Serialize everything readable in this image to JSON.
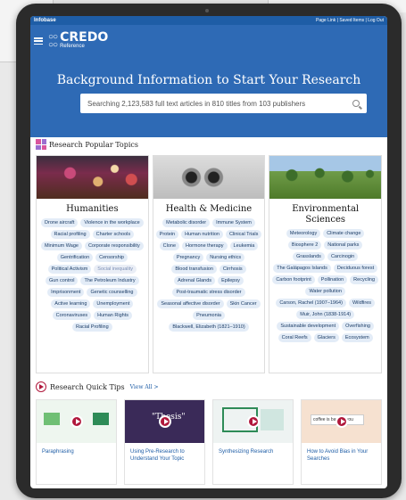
{
  "topstrip": {
    "brand": "Infobase",
    "links": "Page Link | Saved Items | Log Out"
  },
  "header": {
    "logo_word": "CREDO",
    "logo_sub": "Reference",
    "title": "Background Information to Start Your Research",
    "search_placeholder": "Searching 2,123,583 full text articles in 810 titles from 103 publishers"
  },
  "topics": {
    "heading": "Research Popular Topics",
    "columns": [
      {
        "title": "Humanities",
        "tags": [
          "Drone aircraft",
          "Violence in the workplace",
          "Racial profiling",
          "Charter schools",
          "Minimum Wage",
          "Corporate responsibility",
          "Gentrification",
          "Censorship",
          "Political Activism",
          "Social inequality",
          "Gun control",
          "The Petroleum Industry",
          "Imprisonment",
          "Genetic counselling",
          "Active learning",
          "Unemployment",
          "Coronaviruses",
          "Human Rights",
          "Racial Profiling"
        ]
      },
      {
        "title": "Health & Medicine",
        "tags": [
          "Metabolic disorder",
          "Immune System",
          "Protein",
          "Human nutrition",
          "Clinical Trials",
          "Clone",
          "Hormone therapy",
          "Leukemia",
          "Pregnancy",
          "Nursing ethics",
          "Blood transfusion",
          "Cirrhosis",
          "Adrenal Glands",
          "Epilepsy",
          "Post-traumatic stress disorder",
          "Seasonal affective disorder",
          "Skin Cancer",
          "Pneumonia",
          "Blackwell, Elizabeth (1821–1910)"
        ]
      },
      {
        "title": "Environmental Sciences",
        "tags": [
          "Meteorology",
          "Climate change",
          "Biosphere 2",
          "National parks",
          "Grasslands",
          "Carcinogin",
          "The Galápagos Islands",
          "Deciduous forest",
          "Carbon footprint",
          "Pollination",
          "Recycling",
          "Water pollution",
          "Carson, Rachel (1907–1964)",
          "Wildfires",
          "Muir, John (1838-1914)",
          "Sustainable development",
          "Overfishing",
          "Coral Reefs",
          "Glaciers",
          "Ecosystem"
        ]
      }
    ]
  },
  "tips": {
    "heading": "Research Quick Tips",
    "view_all": "View All >",
    "items": [
      {
        "title": "Paraphrasing"
      },
      {
        "title": "Using Pre-Research to Understand Your Topic",
        "thumb_text": "\"Thesis\""
      },
      {
        "title": "Synthesizing Research"
      },
      {
        "title": "How to Avoid Bias in Your Searches",
        "thumb_text": "coffee is bad for you"
      }
    ]
  },
  "colors": {
    "header_blue": "#2e6ab5",
    "tag_bg": "#e3ecf7",
    "play_red": "#b0183c"
  }
}
